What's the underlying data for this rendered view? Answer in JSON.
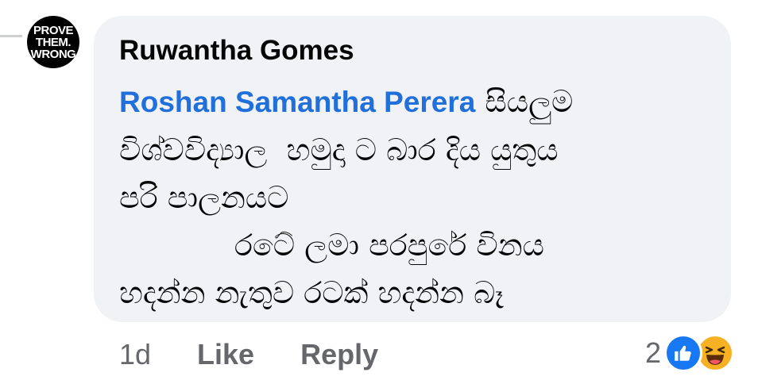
{
  "avatar": {
    "lines": [
      "PROVE",
      "THEM.",
      "WRONG"
    ]
  },
  "comment": {
    "author": "Ruwantha Gomes",
    "mention": "Roshan Samantha Perera",
    "text_first": " සියලුම",
    "lines": [
      "විශ්වවිද්‍යාල  හමුදා ට බාර දිය යුතුය",
      "පරි පාලනයට",
      "            රටේ ලමා පරපුරේ විනය",
      "හදන්න නැතුව රටක් හදන්න බෑ"
    ]
  },
  "actions": {
    "time": "1d",
    "like": "Like",
    "reply": "Reply"
  },
  "reactions": {
    "count": "2",
    "icons": [
      "like-icon",
      "haha-icon"
    ],
    "colors": {
      "like": "#1877f2",
      "haha": "#f7b125"
    }
  }
}
